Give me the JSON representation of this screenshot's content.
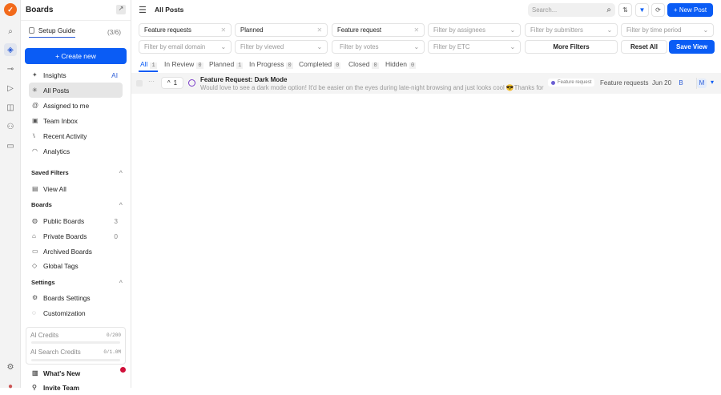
{
  "sidebar": {
    "title": "Boards",
    "setup_guide": "Setup Guide",
    "setup_progress": "(3/6)",
    "create_new": "+ Create new",
    "nav": [
      {
        "label": "Insights",
        "badge": "AI"
      },
      {
        "label": "All Posts"
      },
      {
        "label": "Assigned to me"
      },
      {
        "label": "Team Inbox"
      },
      {
        "label": "Recent Activity"
      },
      {
        "label": "Analytics"
      }
    ],
    "saved_filters": {
      "title": "Saved Filters",
      "items": [
        {
          "label": "View All"
        }
      ]
    },
    "boards": {
      "title": "Boards",
      "items": [
        {
          "label": "Public Boards",
          "count": "3"
        },
        {
          "label": "Private Boards",
          "count": "0"
        },
        {
          "label": "Archived Boards"
        },
        {
          "label": "Global Tags"
        }
      ]
    },
    "settings": {
      "title": "Settings",
      "items": [
        {
          "label": "Boards Settings"
        },
        {
          "label": "Customization"
        }
      ]
    },
    "credits": [
      {
        "label": "AI Credits",
        "value": "0/200",
        "fraction": 0
      },
      {
        "label": "AI Search Credits",
        "value": "0/1.0M",
        "fraction": 0
      }
    ],
    "whats_new": "What's New",
    "invite_team": "Invite Team"
  },
  "header": {
    "title": "All Posts",
    "search_placeholder": "Search...",
    "new_post": "+ New Post"
  },
  "filters": {
    "board": "Feature requests",
    "status": "Planned",
    "tag": "Feature request",
    "assignees": "Filter by assignees",
    "submitters": "Filter by submitters",
    "time": "Filter by time period",
    "email": "Filter by email domain",
    "viewed": "Filter by viewed",
    "votes": "Filter by votes",
    "etc": "Filter by ETC",
    "more": "More Filters",
    "reset": "Reset All",
    "save": "Save View"
  },
  "tabs": [
    {
      "label": "All",
      "count": "1"
    },
    {
      "label": "In Review",
      "count": "0"
    },
    {
      "label": "Planned",
      "count": "1"
    },
    {
      "label": "In Progress",
      "count": "0"
    },
    {
      "label": "Completed",
      "count": "0"
    },
    {
      "label": "Closed",
      "count": "0"
    },
    {
      "label": "Hidden",
      "count": "0"
    }
  ],
  "post": {
    "votes": "1",
    "title": "Feature Request: Dark Mode",
    "body": "Would love to see a dark mode option! It'd be easier on the eyes during late-night browsing and just looks cool 😎Thanks for ...",
    "tag": "Feature request",
    "board": "Feature requests",
    "date": "Jun 20",
    "avatar1": "B",
    "avatar2": "M"
  },
  "colors": {
    "accent": "#0a5cf5",
    "tag_dot": "#6b5fd3"
  }
}
